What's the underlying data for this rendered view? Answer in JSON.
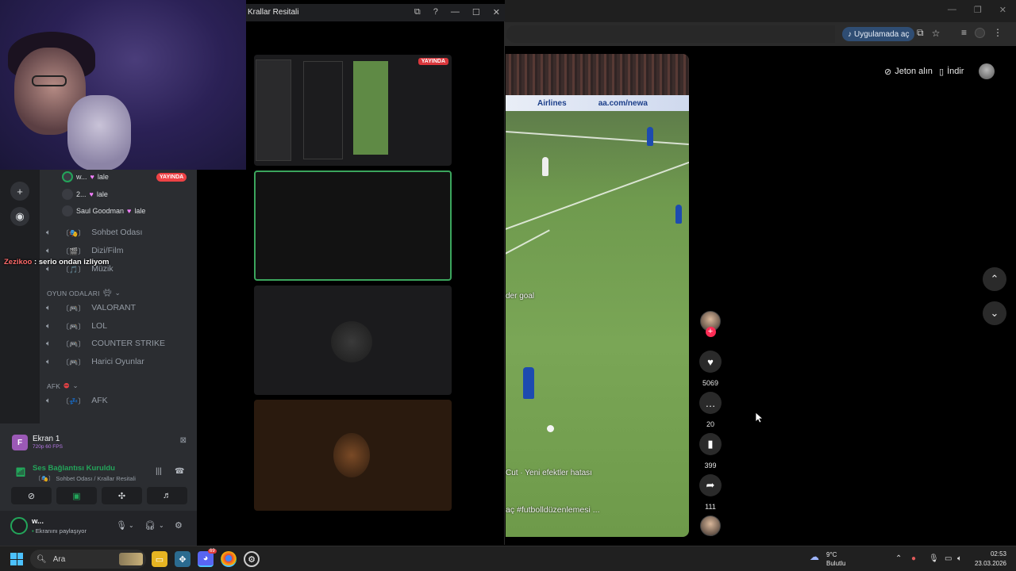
{
  "browser": {
    "open_in_app": "Uygulamada aç",
    "tiktok": {
      "coins": "Jeton alın",
      "download": "İndir",
      "captions": {
        "goal": "der goal",
        "sound": "Cut · Yeni efektler hatası",
        "desc": "aç #futbolldüzenlemesi ..."
      },
      "board_left": "Airlines",
      "board_right": "aa.com/newa",
      "actions": {
        "likes": "5069",
        "comments": "20",
        "saves": "399",
        "shares": "111"
      }
    }
  },
  "viewer": {
    "title": "Krallar Resitali",
    "live_badge": "YAYINDA"
  },
  "discord": {
    "live_badge": "YAYINDA",
    "members": [
      {
        "name": "w...",
        "tag": "lale"
      },
      {
        "name": "2...",
        "tag": "lale"
      },
      {
        "name": "Saul Goodman",
        "tag": "lale"
      }
    ],
    "channels_top": [
      {
        "icon": "〔🎭〕",
        "name": "Sohbet Odası"
      },
      {
        "icon": "〔🎬〕",
        "name": "Dizi/Film"
      },
      {
        "icon": "〔🎵〕",
        "name": "Müzik"
      }
    ],
    "category_games": "OYUN ODALARI",
    "channels_games": [
      {
        "icon": "〔🎮〕",
        "name": "VALORANT"
      },
      {
        "icon": "〔🎮〕",
        "name": "LOL"
      },
      {
        "icon": "〔🎮〕",
        "name": "COUNTER STRIKE"
      },
      {
        "icon": "〔🎮〕",
        "name": "Harici Oyunlar"
      }
    ],
    "category_afk": "AFK",
    "channel_afk": {
      "icon": "〔💤〕",
      "name": "AFK"
    },
    "overlay_chat": {
      "who": "Zezikoo",
      "text": ": serio ondan izliyom"
    },
    "screen_share": {
      "icon_letter": "F",
      "title": "Ekran 1",
      "sub": "720p 60 FPS"
    },
    "voice": {
      "status": "Ses Bağlantısı Kuruldu",
      "channel": "〔🎭〕 Sohbet Odası / Krallar Resitali"
    },
    "user": {
      "name": "w...",
      "status": "Ekranını paylaşıyor"
    }
  },
  "taskbar": {
    "search": "Ara",
    "weather_temp": "9°C",
    "weather_desc": "Bulutlu",
    "time": "02:53",
    "date": "23.03.2026",
    "discord_badge": "69"
  }
}
